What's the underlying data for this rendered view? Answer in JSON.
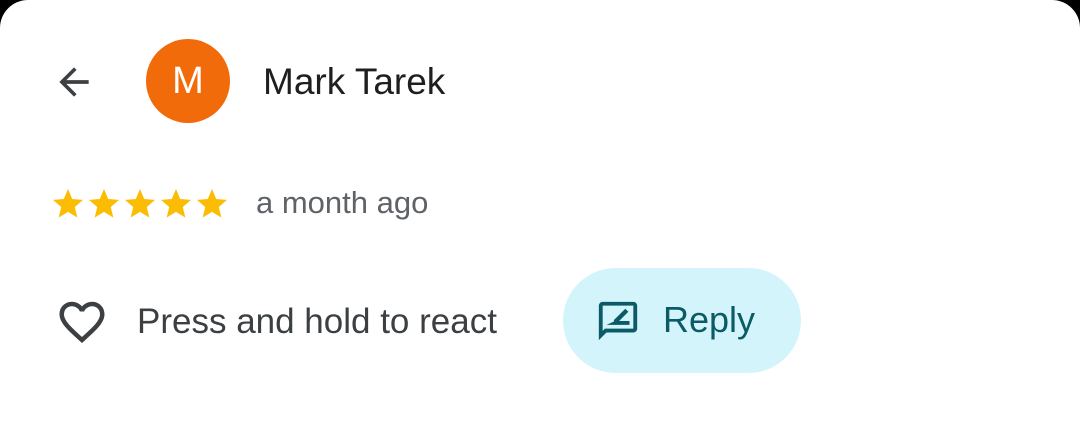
{
  "colors": {
    "avatar_bg": "#f26b0b",
    "star": "#fbbc04",
    "reply_bg": "#d3f4fb",
    "reply_text": "#0b5a66"
  },
  "header": {
    "back_icon": "arrow-back-icon",
    "avatar_initial": "M",
    "author_name": "Mark Tarek"
  },
  "review": {
    "rating": 5,
    "rating_max": 5,
    "time_ago": "a month ago"
  },
  "actions": {
    "react_icon": "heart-outline-icon",
    "react_label": "Press and hold to react",
    "reply_icon": "rate-review-icon",
    "reply_label": "Reply"
  }
}
